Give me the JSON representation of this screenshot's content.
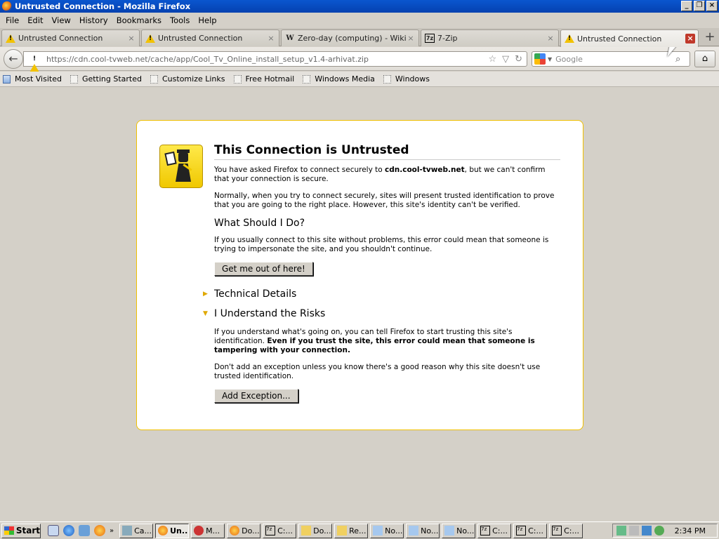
{
  "window": {
    "title": "Untrusted Connection - Mozilla Firefox"
  },
  "menu": [
    "File",
    "Edit",
    "View",
    "History",
    "Bookmarks",
    "Tools",
    "Help"
  ],
  "tabs": [
    {
      "label": "Untrusted Connection",
      "icon": "warning-icon"
    },
    {
      "label": "Untrusted Connection",
      "icon": "warning-icon"
    },
    {
      "label": "Zero-day (computing) - Wikipe...",
      "icon": "wikipedia-icon"
    },
    {
      "label": "7-Zip",
      "icon": "7zip-icon"
    },
    {
      "label": "Untrusted Connection",
      "icon": "warning-icon",
      "active": true
    }
  ],
  "url": "https://cdn.cool-tvweb.net/cache/app/Cool_Tv_Online_install_setup_v1.4-arhivat.zip",
  "search": {
    "placeholder": "Google"
  },
  "bookmarks": [
    "Most Visited",
    "Getting Started",
    "Customize Links",
    "Free Hotmail",
    "Windows Media",
    "Windows"
  ],
  "page": {
    "title": "This Connection is Untrusted",
    "p1_a": "You have asked Firefox to connect securely to ",
    "p1_host": "cdn.cool-tvweb.net",
    "p1_b": ", but we can't confirm that your connection is secure.",
    "p2": "Normally, when you try to connect securely, sites will present trusted identification to prove that you are going to the right place. However, this site's identity can't be verified.",
    "h_what": "What Should I Do?",
    "p3": "If you usually connect to this site without problems, this error could mean that someone is trying to impersonate the site, and you shouldn't continue.",
    "btn_out": "Get me out of here!",
    "tech": "Technical Details",
    "risks": "I Understand the Risks",
    "p4_a": "If you understand what's going on, you can tell Firefox to start trusting this site's identification. ",
    "p4_b": "Even if you trust the site, this error could mean that someone is tampering with your connection.",
    "p5": "Don't add an exception unless you know there's a good reason why this site doesn't use trusted identification.",
    "btn_exc": "Add Exception..."
  },
  "taskbar": {
    "start": "Start",
    "buttons": [
      "Ca...",
      "Un...",
      "M...",
      "Do...",
      "C:...",
      "Do...",
      "Re...",
      "No...",
      "No...",
      "No...",
      "C:...",
      "C:...",
      "C:..."
    ],
    "clock": "2:34 PM"
  },
  "colors": {
    "warning_yellow": "#f2c200",
    "box_border": "#f0c000",
    "title_blue": "#0a56cf"
  }
}
